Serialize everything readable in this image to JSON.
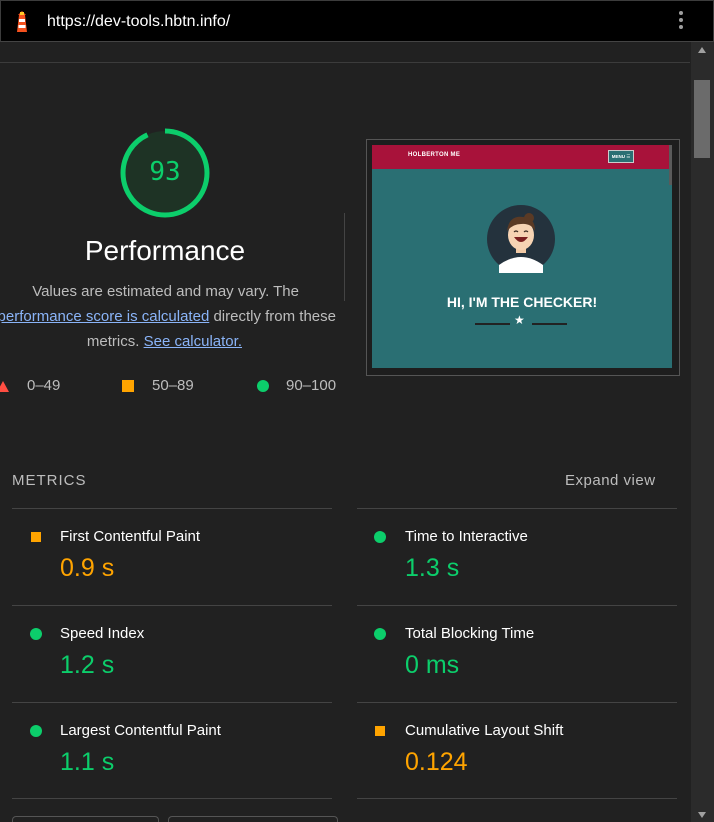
{
  "browser": {
    "url": "https://dev-tools.hbtn.info/",
    "icon": "lighthouse-icon",
    "menu_icon": "kebab-menu-icon"
  },
  "performance": {
    "score": "93",
    "title": "Performance",
    "desc_line1": "Values are estimated and may vary. The",
    "desc_link1": "performance score is calculated",
    "desc_line2_rest": " directly from these",
    "desc_line3": "metrics.",
    "desc_link2": "See calculator.",
    "score_color": "#0cce6b"
  },
  "legend": {
    "fail": "0–49",
    "average": "50–89",
    "pass": "90–100"
  },
  "screenshot": {
    "brand": "HOLBERTON ME",
    "menu": "MENU ☰",
    "heading": "HI, I'M THE CHECKER!",
    "star": "★"
  },
  "metrics": {
    "heading": "METRICS",
    "expand": "Expand view",
    "items": [
      {
        "label": "First Contentful Paint",
        "value": "0.9 s",
        "status": "average"
      },
      {
        "label": "Time to Interactive",
        "value": "1.3 s",
        "status": "pass"
      },
      {
        "label": "Speed Index",
        "value": "1.2 s",
        "status": "pass"
      },
      {
        "label": "Total Blocking Time",
        "value": "0 ms",
        "status": "pass"
      },
      {
        "label": "Largest Contentful Paint",
        "value": "1.1 s",
        "status": "pass"
      },
      {
        "label": "Cumulative Layout Shift",
        "value": "0.124",
        "status": "average"
      }
    ]
  },
  "colors": {
    "pass": "#0cce6b",
    "average": "#ffa400",
    "fail": "#ff4e42",
    "link": "#8ab4f8"
  }
}
